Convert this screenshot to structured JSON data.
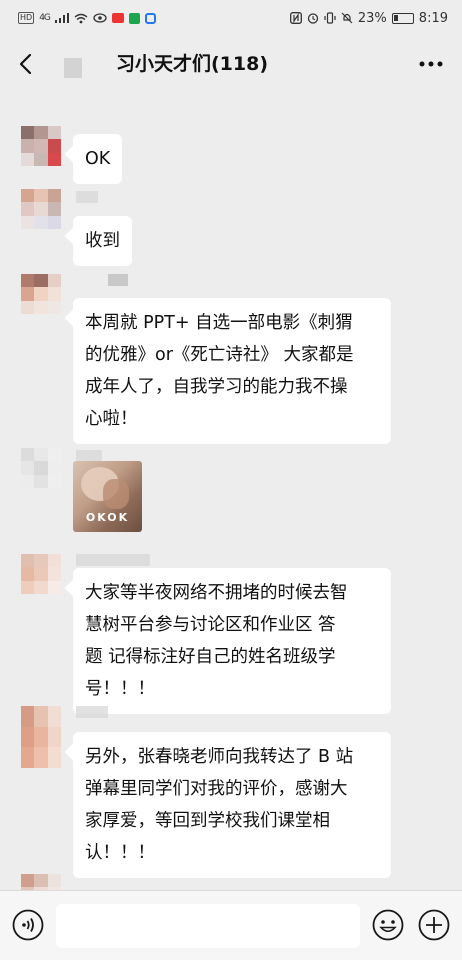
{
  "status_bar": {
    "hd": "HD",
    "signal": "4G",
    "battery_percent": "23%",
    "time": "8:19"
  },
  "nav": {
    "title": "习小天才们(118)"
  },
  "messages": [
    {
      "type": "text",
      "text": "OK"
    },
    {
      "type": "text",
      "text": "收到"
    },
    {
      "type": "text",
      "lines": [
        "本周就 PPT+ 自选一部电影《刺猬",
        "的优雅》or《死亡诗社》 大家都是",
        "成年人了，自我学习的能力我不操",
        "心啦！"
      ]
    },
    {
      "type": "image",
      "caption": "OKOK"
    },
    {
      "type": "text",
      "lines": [
        "大家等半夜网络不拥堵的时候去智",
        "慧树平台参与讨论区和作业区 答",
        "题  记得标注好自己的姓名班级学",
        "号！！！"
      ]
    },
    {
      "type": "text",
      "lines": [
        "另外，张春晓老师向我转达了 B 站",
        "弹幕里同学们对我的评价，感谢大",
        "家厚爱，等回到学校我们课堂相",
        "认！！！"
      ]
    }
  ],
  "input_bar": {
    "placeholder": "",
    "value": ""
  },
  "icons": {
    "back": "back-arrow-icon",
    "more": "more-dots-icon",
    "voice": "voice-icon",
    "emoji": "emoji-icon",
    "plus": "plus-icon"
  }
}
